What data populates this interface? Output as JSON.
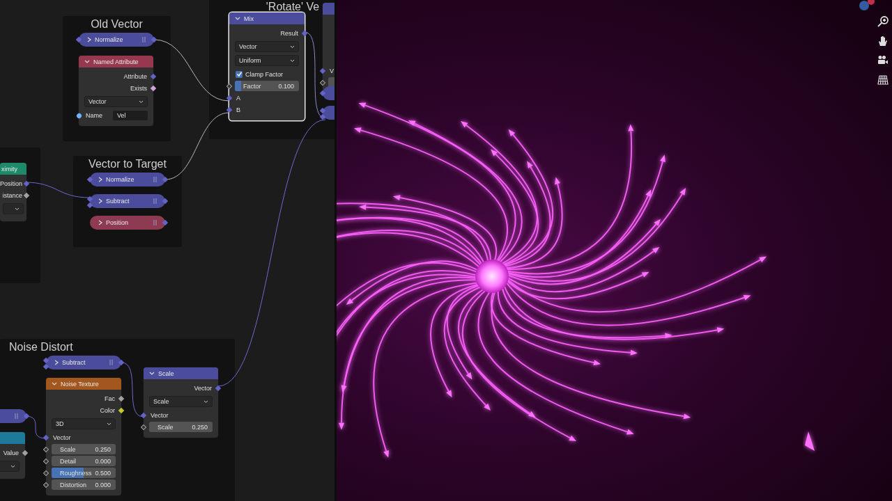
{
  "node_editor": {
    "frames": [
      {
        "label": "Old Vector"
      },
      {
        "label": "'Rotate' Ve"
      },
      {
        "label": "Vector to Target"
      },
      {
        "label": "Noise Distort"
      }
    ],
    "nodes": [
      {
        "kind": "collapsed",
        "title": "Normalize",
        "color": "#4c4c9c"
      },
      {
        "kind": "node",
        "title": "Named Attribute",
        "color": "#98384f",
        "selected": false,
        "rows": [
          {
            "kind": "output",
            "label": "Attribute",
            "color": "#6363c7"
          },
          {
            "kind": "output",
            "label": "Exists",
            "color": "#cca6d6"
          },
          {
            "kind": "dropdown",
            "value": "Vector"
          },
          {
            "kind": "field",
            "label": "Name",
            "value": "Vel",
            "color": "#70b2ff"
          }
        ]
      },
      {
        "kind": "node",
        "title": "Mix",
        "color": "#4c4c9c",
        "selected": true,
        "rows": [
          {
            "kind": "output",
            "label": "Result",
            "color": "#6363c7"
          },
          {
            "kind": "dropdown",
            "value": "Vector"
          },
          {
            "kind": "dropdown",
            "value": "Uniform"
          },
          {
            "kind": "checkbox",
            "label": "Clamp Factor",
            "checked": true
          },
          {
            "kind": "slider",
            "label": "Factor",
            "value": "0.100",
            "level": 0.1
          },
          {
            "kind": "input",
            "label": "A",
            "color": "#6363c7"
          },
          {
            "kind": "input",
            "label": "B",
            "color": "#6363c7"
          }
        ]
      },
      {
        "kind": "node",
        "color": "#4c4c9c",
        "selected": false,
        "rows": [
          {
            "kind": "spacer"
          },
          {
            "kind": "spacer"
          },
          {
            "kind": "spacer"
          },
          {
            "kind": "spacer"
          },
          {
            "kind": "input",
            "label": "V",
            "color": "#6363c7"
          },
          {
            "kind": "number"
          }
        ]
      },
      {
        "kind": "collapsed",
        "color": "#4c4c9c"
      },
      {
        "kind": "collapsed",
        "color": "#4c4c9c"
      },
      {
        "kind": "node",
        "title": "ximity",
        "color": "#1e8a6a",
        "selected": false,
        "rows": [
          {
            "kind": "output",
            "label": "Position",
            "color": "#6363c7"
          },
          {
            "kind": "output",
            "label": "istance",
            "color": "#a1a1a1"
          },
          {
            "kind": "dropdown"
          }
        ]
      },
      {
        "kind": "collapsed",
        "title": "Normalize",
        "color": "#4c4c9c"
      },
      {
        "kind": "collapsed",
        "title": "Subtract",
        "color": "#4c4c9c"
      },
      {
        "kind": "collapsed",
        "title": "Position",
        "color": "#8e3a52"
      },
      {
        "kind": "collapsed",
        "title": "Subtract",
        "color": "#4c4c9c"
      },
      {
        "kind": "node",
        "title": "Noise Texture",
        "color": "#a4561f",
        "selected": false,
        "rows": [
          {
            "kind": "output",
            "label": "Fac",
            "color": "#a1a1a1"
          },
          {
            "kind": "output",
            "label": "Color",
            "color": "#c7c729"
          },
          {
            "kind": "dropdown",
            "value": "3D"
          },
          {
            "kind": "input",
            "label": "Vector",
            "color": "#6363c7"
          },
          {
            "kind": "number",
            "label": "Scale",
            "value": "0.250"
          },
          {
            "kind": "number",
            "label": "Detail",
            "value": "0.000"
          },
          {
            "kind": "slider",
            "label": "Roughness",
            "value": "0.500",
            "level": 0.5
          },
          {
            "kind": "number",
            "label": "Distortion",
            "value": "0.000"
          }
        ]
      },
      {
        "kind": "node",
        "title": "Scale",
        "color": "#4c4c9c",
        "selected": false,
        "rows": [
          {
            "kind": "output",
            "label": "Vector",
            "color": "#6363c7"
          },
          {
            "kind": "dropdown",
            "value": "Scale"
          },
          {
            "kind": "input",
            "label": "Vector",
            "color": "#6363c7"
          },
          {
            "kind": "number",
            "label": "Scale",
            "value": "0.250"
          }
        ]
      },
      {
        "kind": "collapsed",
        "color": "#4c4c9c"
      },
      {
        "kind": "node",
        "color": "#1d7a9a",
        "selected": false,
        "rows": [
          {
            "kind": "output",
            "label": "Value",
            "color": "#a1a1a1"
          },
          {
            "kind": "dropdown"
          }
        ]
      }
    ]
  }
}
